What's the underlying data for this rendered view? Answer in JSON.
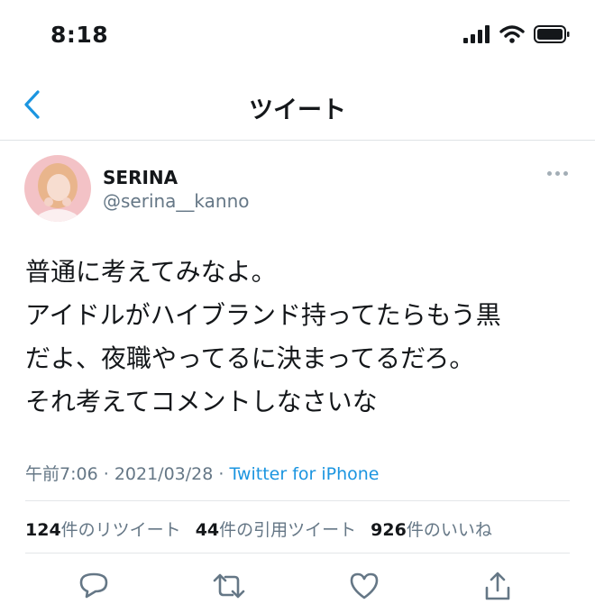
{
  "status_bar": {
    "time": "8:18"
  },
  "nav": {
    "title": "ツイート"
  },
  "tweet": {
    "display_name": "SERINA",
    "handle": "@serina__kanno",
    "lines": [
      "普通に考えてみなよ。",
      "アイドルがハイブランド持ってたらもう黒",
      "だよ、夜職やってるに決まってるだろ。",
      "それ考えてコメントしなさいな"
    ],
    "time": "午前7:06",
    "separator": "·",
    "date": "2021/03/28",
    "source": "Twitter for iPhone"
  },
  "stats": {
    "retweets_count": "124",
    "retweets_label": "件のリツイート",
    "quotes_count": "44",
    "quotes_label": "件の引用ツイート",
    "likes_count": "926",
    "likes_label": "件のいいね"
  },
  "colors": {
    "accent": "#1b95e0",
    "secondary_text": "#657786",
    "divider": "#e3e6e9"
  },
  "icons": [
    "back-chevron-icon",
    "signal-icon",
    "wifi-icon",
    "battery-icon",
    "more-icon",
    "reply-icon",
    "retweet-icon",
    "like-icon",
    "share-icon"
  ]
}
